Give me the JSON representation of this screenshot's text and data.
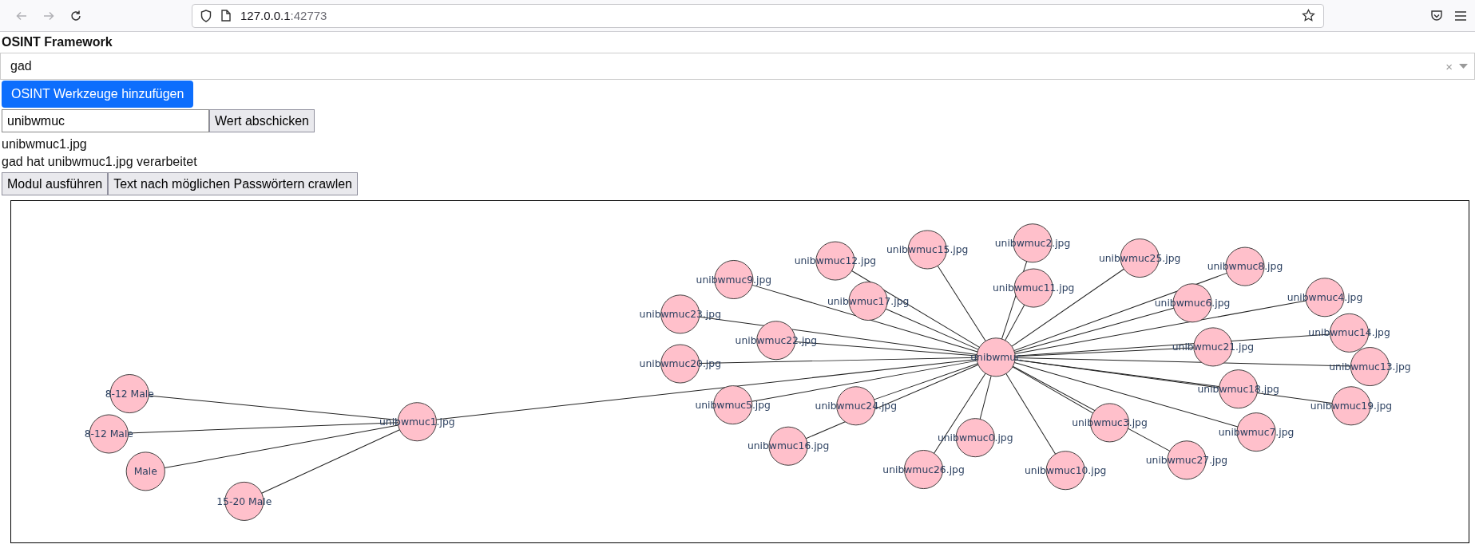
{
  "browser": {
    "url_host": "127.0.0.1",
    "url_port": ":42773"
  },
  "title": "OSINT Framework",
  "select": {
    "value": "gad",
    "clear": "×"
  },
  "add_button": "OSINT Werkzeuge hinzufügen",
  "input": {
    "value": "unibwmuc"
  },
  "submit_button": "Wert abschicken",
  "messages": [
    "unibwmuc1.jpg",
    "gad hat unibwmuc1.jpg verarbeitet"
  ],
  "action_buttons": [
    "Modul ausführen",
    "Text nach möglichen Passwörtern crawlen"
  ],
  "graph": {
    "root": {
      "label": "unibwmuc",
      "children": [
        {
          "label": "unibwmuc12.jpg"
        },
        {
          "label": "unibwmuc15.jpg"
        },
        {
          "label": "unibwmuc2.jpg"
        },
        {
          "label": "unibwmuc25.jpg"
        },
        {
          "label": "unibwmuc8.jpg"
        },
        {
          "label": "unibwmuc23.jpg"
        },
        {
          "label": "unibwmuc9.jpg"
        },
        {
          "label": "unibwmuc17.jpg"
        },
        {
          "label": "unibwmuc11.jpg"
        },
        {
          "label": "unibwmuc6.jpg"
        },
        {
          "label": "unibwmuc4.jpg"
        },
        {
          "label": "unibwmuc20.jpg"
        },
        {
          "label": "unibwmuc22.jpg"
        },
        {
          "label": "unibwmuc21.jpg"
        },
        {
          "label": "unibwmuc14.jpg"
        },
        {
          "label": "unibwmuc13.jpg"
        },
        {
          "label": "unibwmuc5.jpg"
        },
        {
          "label": "unibwmuc24.jpg"
        },
        {
          "label": "unibwmuc18.jpg"
        },
        {
          "label": "unibwmuc19.jpg"
        },
        {
          "label": "unibwmuc1.jpg",
          "children": [
            {
              "label": "8-12 Male"
            },
            {
              "label": "8-12 Male"
            },
            {
              "label": "Male"
            },
            {
              "label": "15-20 Male"
            }
          ]
        },
        {
          "label": "unibwmuc16.jpg"
        },
        {
          "label": "unibwmuc0.jpg"
        },
        {
          "label": "unibwmuc3.jpg"
        },
        {
          "label": "unibwmuc7.jpg"
        },
        {
          "label": "unibwmuc26.jpg"
        },
        {
          "label": "unibwmuc10.jpg"
        },
        {
          "label": "unibwmuc27.jpg"
        }
      ]
    }
  }
}
